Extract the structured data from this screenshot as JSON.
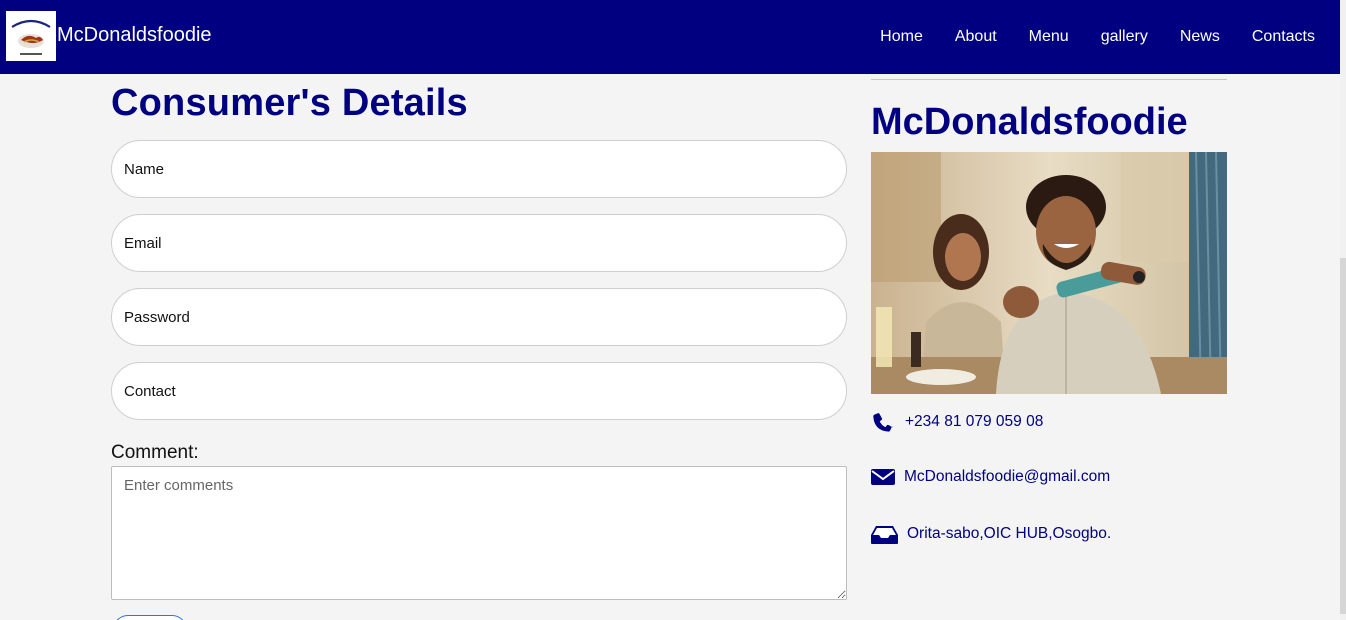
{
  "nav": {
    "brand": "McDonaldsfoodie",
    "logo_text": "McDonaldsfoodie",
    "logo_icon": "restaurant-logo",
    "links": [
      "Home",
      "About",
      "Menu",
      "gallery",
      "News",
      "Contacts"
    ]
  },
  "form": {
    "title": "Consumer's Details",
    "name_placeholder": "Name",
    "email_placeholder": "Email",
    "password_placeholder": "Password",
    "contact_placeholder": "Contact",
    "comment_label": "Comment:",
    "comment_placeholder": "Enter comments"
  },
  "sidebar": {
    "title": "McDonaldsfoodie",
    "photo_icon": "customer-paying-photo",
    "phone_icon": "phone-icon",
    "phone": "+234 81 079 059 08",
    "email_icon": "envelope-icon",
    "email": "McDonaldsfoodie@gmail.com",
    "address_icon": "inbox-icon",
    "address": "Orita-sabo,OIC HUB,Osogbo."
  },
  "colors": {
    "primary": "#000080",
    "background": "#f4f4f4",
    "button_border": "#3a6fd8"
  }
}
